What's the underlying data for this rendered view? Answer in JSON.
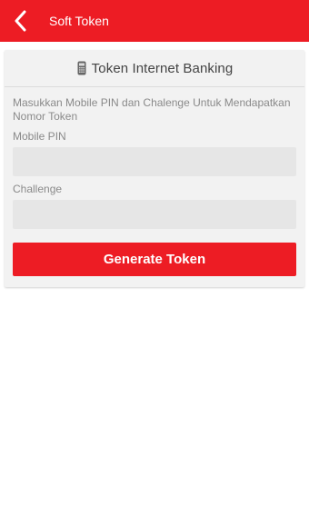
{
  "app_bar": {
    "title": "Soft Token",
    "back_icon": "chevron-left-icon",
    "color": "#ed1c24"
  },
  "card": {
    "header": {
      "icon": "token-device-icon",
      "title": "Token Internet Banking"
    },
    "instruction": "Masukkan Mobile PIN dan Chalenge Untuk Mendapatkan Nomor Token",
    "fields": [
      {
        "label": "Mobile PIN",
        "value": "",
        "placeholder": ""
      },
      {
        "label": "Challenge",
        "value": "",
        "placeholder": ""
      }
    ],
    "button_label": "Generate Token"
  }
}
